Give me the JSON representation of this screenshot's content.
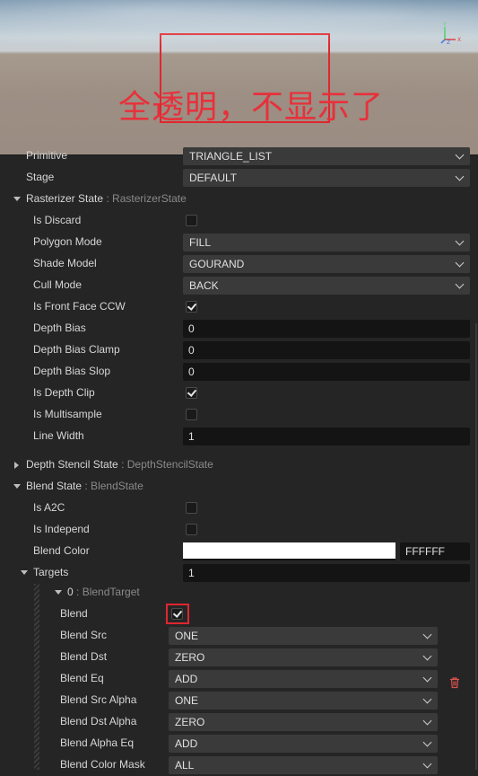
{
  "viewport": {
    "annotation_text": "全透明，不显示了",
    "gizmo": {
      "y_label": "Y",
      "x_label": "X",
      "z_label": "Z"
    }
  },
  "props": {
    "primitive": {
      "label": "Primitive",
      "value": "TRIANGLE_LIST"
    },
    "stage": {
      "label": "Stage",
      "value": "DEFAULT"
    },
    "rasterizer": {
      "label": "Rasterizer State",
      "type": ": RasterizerState",
      "is_discard": {
        "label": "Is Discard",
        "checked": false
      },
      "polygon_mode": {
        "label": "Polygon Mode",
        "value": "FILL"
      },
      "shade_model": {
        "label": "Shade Model",
        "value": "GOURAND"
      },
      "cull_mode": {
        "label": "Cull Mode",
        "value": "BACK"
      },
      "front_ccw": {
        "label": "Is Front Face CCW",
        "checked": true
      },
      "depth_bias": {
        "label": "Depth Bias",
        "value": "0"
      },
      "depth_bias_clamp": {
        "label": "Depth Bias Clamp",
        "value": "0"
      },
      "depth_bias_slop": {
        "label": "Depth Bias Slop",
        "value": "0"
      },
      "depth_clip": {
        "label": "Is Depth Clip",
        "checked": true
      },
      "multisample": {
        "label": "Is Multisample",
        "checked": false
      },
      "line_width": {
        "label": "Line Width",
        "value": "1"
      }
    },
    "depth_stencil": {
      "label": "Depth Stencil State",
      "type": ": DepthStencilState"
    },
    "blend": {
      "label": "Blend State",
      "type": ": BlendState",
      "a2c": {
        "label": "Is A2C",
        "checked": false
      },
      "independ": {
        "label": "Is Independ",
        "checked": false
      },
      "blend_color": {
        "label": "Blend Color",
        "value": "FFFFFF",
        "color": "#ffffff"
      },
      "targets": {
        "label": "Targets",
        "value": "1"
      },
      "target0": {
        "label": "0",
        "type": ": BlendTarget",
        "blend": {
          "label": "Blend",
          "checked": true
        },
        "src": {
          "label": "Blend Src",
          "value": "ONE"
        },
        "dst": {
          "label": "Blend Dst",
          "value": "ZERO"
        },
        "eq": {
          "label": "Blend Eq",
          "value": "ADD"
        },
        "src_alpha": {
          "label": "Blend Src Alpha",
          "value": "ONE"
        },
        "dst_alpha": {
          "label": "Blend Dst Alpha",
          "value": "ZERO"
        },
        "alpha_eq": {
          "label": "Blend Alpha Eq",
          "value": "ADD"
        },
        "color_mask": {
          "label": "Blend Color Mask",
          "value": "ALL"
        }
      }
    }
  },
  "icons": {
    "delete": "trash-icon"
  },
  "colors": {
    "highlight": "#e0262e",
    "panel_bg": "#252526",
    "dropdown_bg": "#3a3a3a",
    "input_bg": "#141414"
  }
}
